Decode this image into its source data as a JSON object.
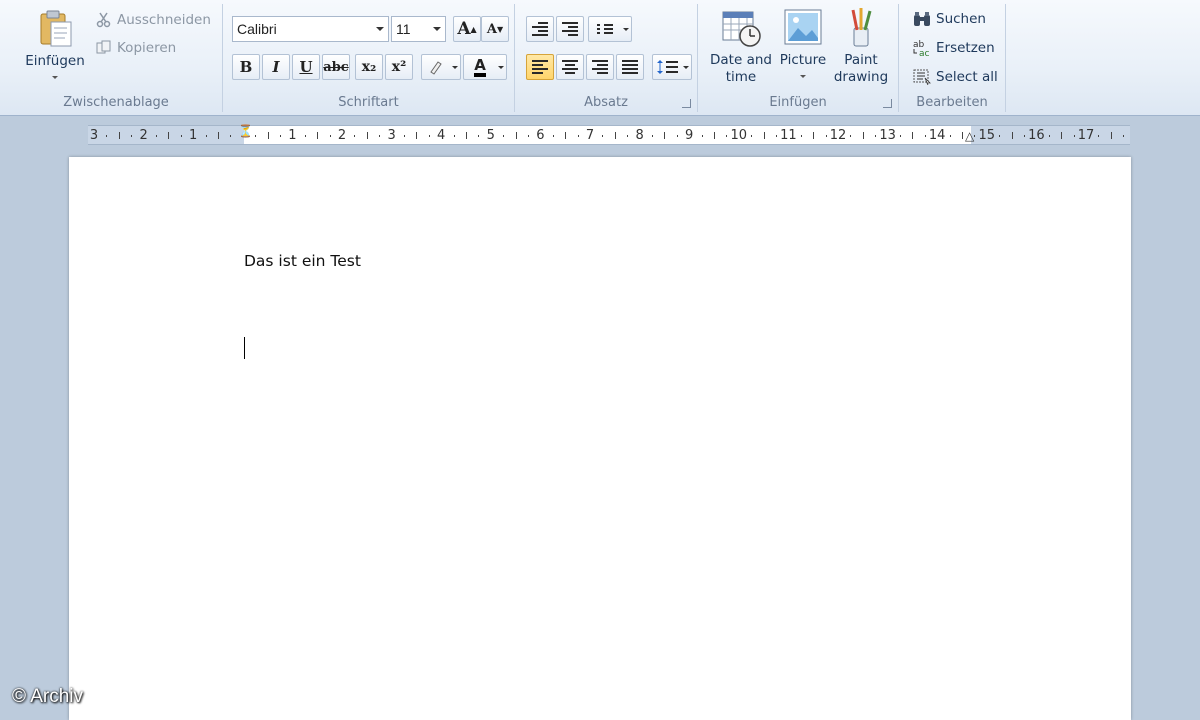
{
  "ribbon": {
    "clipboard": {
      "label": "Zwischenablage",
      "paste": "Einfügen",
      "cut": "Ausschneiden",
      "copy": "Kopieren"
    },
    "font": {
      "label": "Schriftart",
      "family": "Calibri",
      "size": "11",
      "bold": "B",
      "italic": "I",
      "underline": "U",
      "strikethrough": "abc",
      "subscript": "x₂",
      "superscript": "x²",
      "grow": "A",
      "shrink": "A",
      "color": "A"
    },
    "paragraph": {
      "label": "Absatz",
      "active_alignment": "left"
    },
    "insert": {
      "label": "Einfügen",
      "date_time": "Date and time",
      "picture": "Picture",
      "paint_drawing": "Paint drawing"
    },
    "editing": {
      "label": "Bearbeiten",
      "find": "Suchen",
      "replace": "Ersetzen",
      "select_all": "Select all"
    }
  },
  "ruler": {
    "labels": [
      "3",
      "2",
      "1",
      "1",
      "2",
      "3",
      "4",
      "5",
      "6",
      "7",
      "8",
      "9",
      "10",
      "11",
      "12",
      "13",
      "14",
      "15",
      "16",
      "17"
    ]
  },
  "document": {
    "text": "Das ist ein Test"
  },
  "watermark": "© Archiv",
  "colors": {
    "ribbon_top": "#f6f9fd",
    "ribbon_bottom": "#dde7f3",
    "workspace": "#bccbdc",
    "active_button": "#ffd56b",
    "text_accent": "#1e395b"
  }
}
